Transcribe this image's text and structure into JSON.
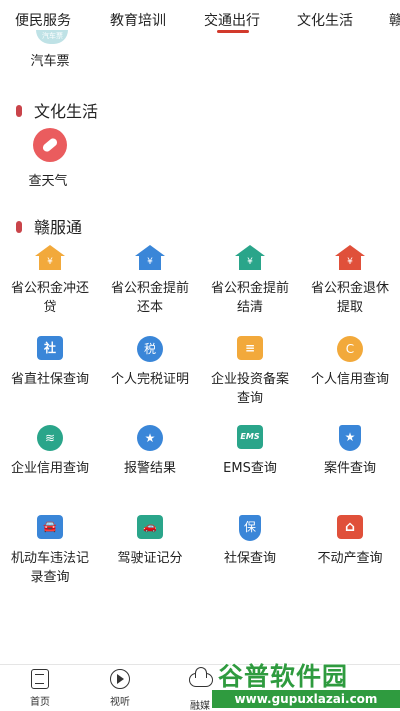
{
  "tabs": [
    {
      "label": "便民服务"
    },
    {
      "label": "教育培训"
    },
    {
      "label": "交通出行"
    },
    {
      "label": "文化生活"
    },
    {
      "label": "赣"
    }
  ],
  "partial_service": {
    "label": "汽车票",
    "badge": "汽车票"
  },
  "culture": {
    "title": "文化生活",
    "items": [
      {
        "label": "查天气"
      }
    ]
  },
  "ganfutong": {
    "title": "赣服通",
    "items": [
      {
        "label": "省公积金冲还贷",
        "icon": "house-yuan-icon",
        "color": "#f2a93b",
        "glyph": "¥"
      },
      {
        "label": "省公积金提前还本",
        "icon": "house-yuan-icon",
        "color": "#3a86d8",
        "glyph": "¥"
      },
      {
        "label": "省公积金提前结清",
        "icon": "house-yuan-icon",
        "color": "#2aa58a",
        "glyph": "¥"
      },
      {
        "label": "省公积金退休提取",
        "icon": "house-yuan-icon",
        "color": "#e0503a",
        "glyph": "¥"
      },
      {
        "label": "省直社保查询",
        "icon": "social-security-icon",
        "color": "#3a86d8",
        "glyph": "社"
      },
      {
        "label": "个人完税证明",
        "icon": "tax-hand-icon",
        "color": "#3a86d8",
        "glyph": "税"
      },
      {
        "label": "企业投资备案查询",
        "icon": "document-coin-icon",
        "color": "#f2a93b",
        "glyph": "≡"
      },
      {
        "label": "个人信用查询",
        "icon": "credit-icon",
        "color": "#f2a93b",
        "glyph": "C"
      },
      {
        "label": "企业信用查询",
        "icon": "enterprise-credit-icon",
        "color": "#2aa58a",
        "glyph": "≋"
      },
      {
        "label": "报警结果",
        "icon": "police-cap-icon",
        "color": "#3a86d8",
        "glyph": "★"
      },
      {
        "label": "EMS查询",
        "icon": "ems-icon",
        "color": "#2aa58a",
        "glyph": "EMS"
      },
      {
        "label": "案件查询",
        "icon": "badge-star-icon",
        "color": "#3a86d8",
        "glyph": "★"
      },
      {
        "label": "机动车违法记录查询",
        "icon": "car-search-icon",
        "color": "#3a86d8",
        "glyph": "🚘"
      },
      {
        "label": "驾驶证记分",
        "icon": "car-icon",
        "color": "#2aa58a",
        "glyph": "🚗"
      },
      {
        "label": "社保查询",
        "icon": "shield-icon",
        "color": "#3a86d8",
        "glyph": "保"
      },
      {
        "label": "不动产查询",
        "icon": "real-estate-icon",
        "color": "#e0503a",
        "glyph": "⌂"
      }
    ]
  },
  "bottom_nav": [
    {
      "label": "首页",
      "icon": "home-doc-icon"
    },
    {
      "label": "视听",
      "icon": "play-icon"
    },
    {
      "label": "融媒",
      "icon": "cloud-icon"
    }
  ],
  "watermark": {
    "title": "谷普软件园",
    "url": "www.gupuxlazai.com"
  },
  "colors": {
    "accent": "#d23a2c",
    "section_bar": "#c9444a",
    "weather": "#ea5c5e",
    "watermark": "#2f9b3f"
  }
}
